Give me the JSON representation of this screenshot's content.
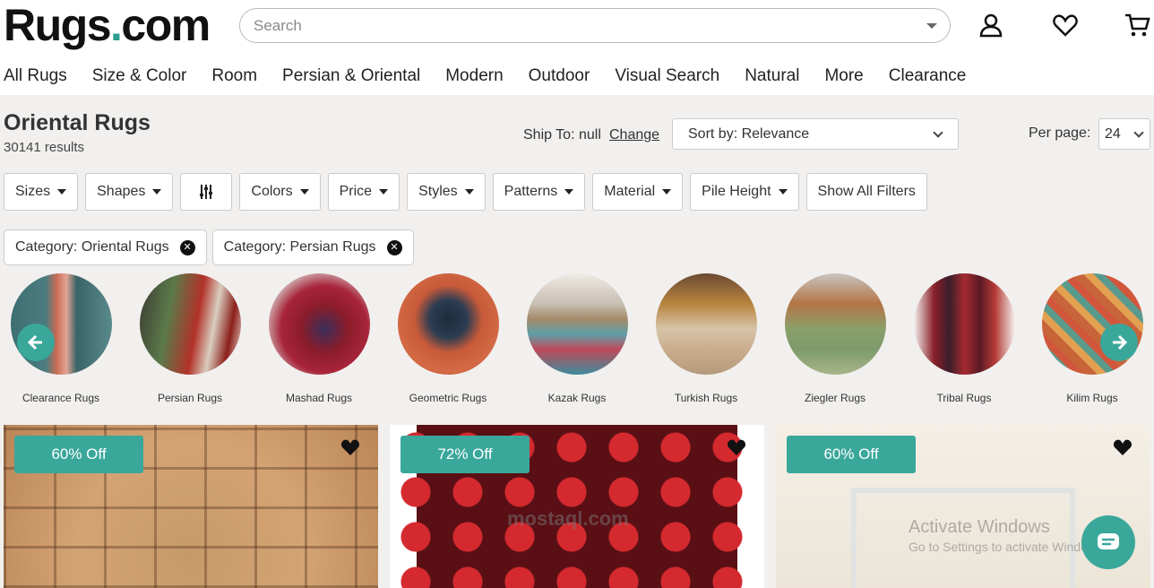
{
  "header": {
    "logo": "Rugs",
    "logo_dot": ".",
    "logo_tld": "com",
    "search_placeholder": "Search",
    "icons": [
      "user-icon",
      "heart-icon",
      "cart-icon"
    ]
  },
  "nav": [
    "All Rugs",
    "Size & Color",
    "Room",
    "Persian & Oriental",
    "Modern",
    "Outdoor",
    "Visual Search",
    "Natural",
    "More",
    "Clearance"
  ],
  "listing": {
    "title": "Oriental Rugs",
    "results": "30141 results",
    "ship_to": "Ship To: null",
    "change": "Change",
    "sort": "Sort by: Relevance",
    "per_page_label": "Per page:",
    "per_page": "24"
  },
  "filters": [
    "Sizes",
    "Shapes",
    "Colors",
    "Price",
    "Styles",
    "Patterns",
    "Material",
    "Pile Height"
  ],
  "show_all_filters": "Show All Filters",
  "chips": [
    "Category: Oriental Rugs",
    "Category: Persian Rugs"
  ],
  "categories": [
    "Clearance Rugs",
    "Persian Rugs",
    "Mashad Rugs",
    "Geometric Rugs",
    "Kazak Rugs",
    "Turkish Rugs",
    "Ziegler Rugs",
    "Tribal Rugs",
    "Kilim Rugs"
  ],
  "products": [
    {
      "badge": "60% Off"
    },
    {
      "badge": "72% Off"
    },
    {
      "badge": "60% Off"
    }
  ],
  "overlay": {
    "activate_title": "Activate Windows",
    "activate_sub": "Go to Settings to activate Windows.",
    "mostaql": "mostaql.com"
  },
  "colors": {
    "accent": "#3aa79b",
    "background": "#f2f0ee"
  }
}
